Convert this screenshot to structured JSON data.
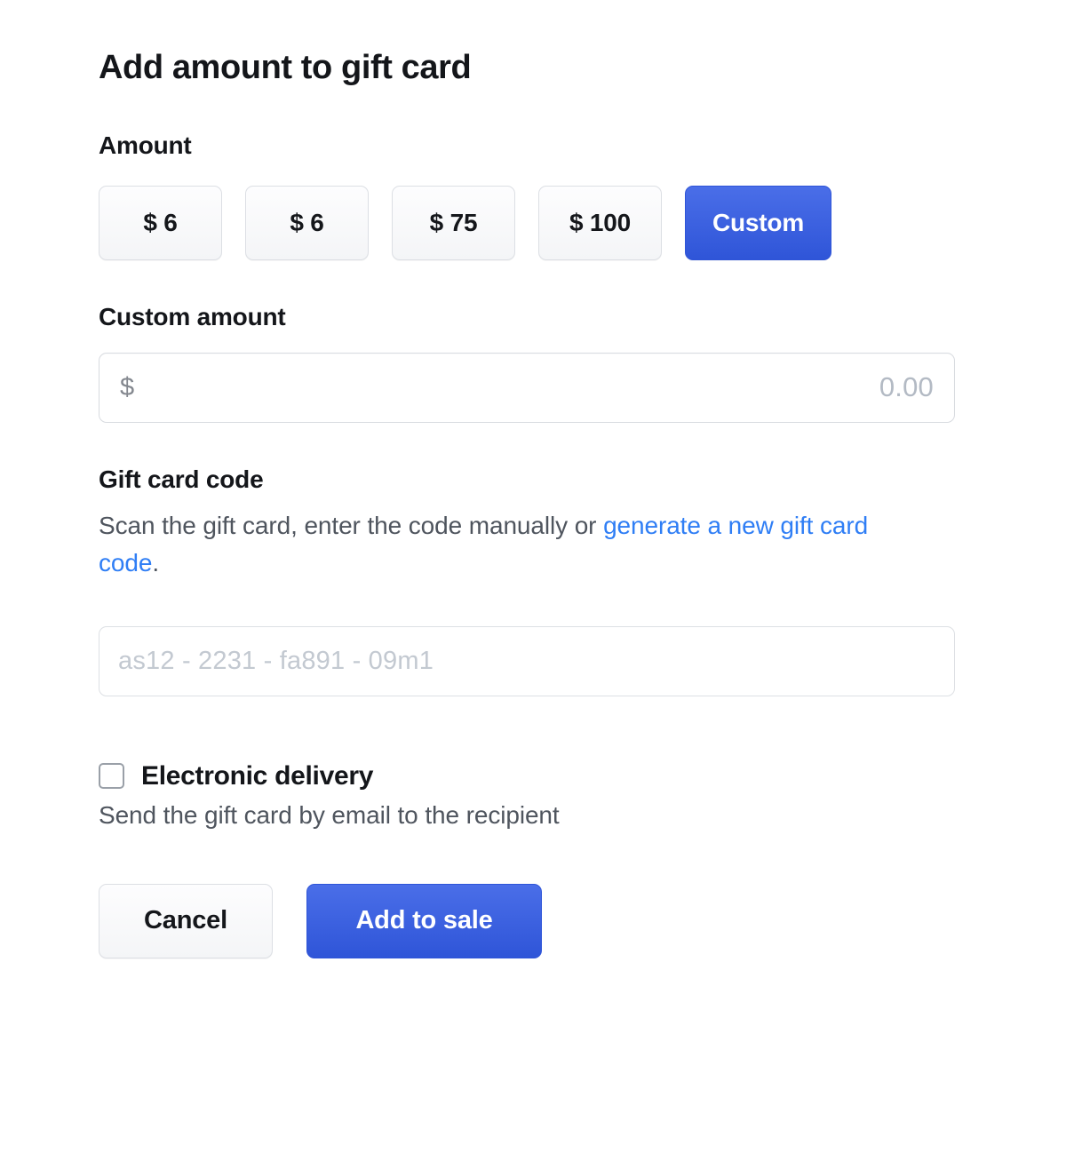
{
  "page": {
    "title": "Add amount to gift card",
    "accent_color": "#3558dc",
    "link_color": "#2f7ef5",
    "background": "#ffffff"
  },
  "amount_section": {
    "label": "Amount",
    "options": [
      {
        "label": "$ 6",
        "selected": false
      },
      {
        "label": "$ 6",
        "selected": false
      },
      {
        "label": "$ 75",
        "selected": false
      },
      {
        "label": "$ 100",
        "selected": false
      },
      {
        "label": "Custom",
        "selected": true
      }
    ]
  },
  "custom_amount": {
    "label": "Custom amount",
    "currency_symbol": "$",
    "value": "0.00"
  },
  "gift_card_code": {
    "label": "Gift card code",
    "description_prefix": "Scan the gift card, enter the code manually or ",
    "description_link": "generate a new gift card code",
    "description_suffix": ".",
    "placeholder": "as12 - 2231 - fa891 - 09m1",
    "value": ""
  },
  "electronic_delivery": {
    "label": "Electronic delivery",
    "description": "Send the gift card by email to the recipient",
    "checked": false
  },
  "footer": {
    "cancel_label": "Cancel",
    "submit_label": "Add to sale"
  }
}
